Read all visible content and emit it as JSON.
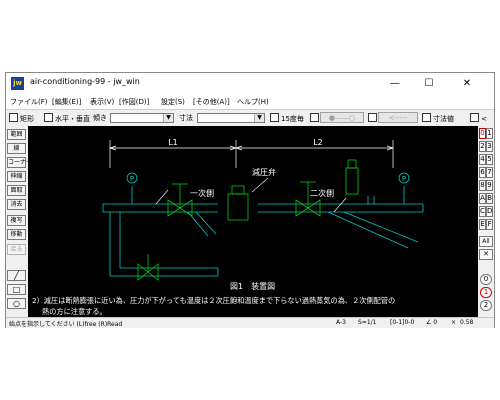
{
  "window": {
    "app_icon_text": "jw",
    "title": "air-conditioning-99 - jw_win",
    "minimize": "—",
    "maximize": "☐",
    "close": "✕"
  },
  "menu": [
    "ファイル(F)",
    "[編集(E)]",
    "表示(V)",
    "[作図(D)]",
    "設定(S)",
    "[その他(A)]",
    "ヘルプ(H)"
  ],
  "toolbar": {
    "rect": "矩形",
    "horiz_vert": "水平・垂直",
    "slope_label": "傾き",
    "dimension_label": "寸法",
    "deg15": "15度毎",
    "grayed_1": "●——○",
    "grayed_2": "<-----",
    "dim_value": "寸法値",
    "lt": "<"
  },
  "left_tools": [
    "範囲",
    "線",
    "コーナー",
    "伸縮",
    "面取",
    "消去",
    "複写",
    "移動",
    "戻る"
  ],
  "right_layers": [
    "0",
    "1",
    "2",
    "3",
    "4",
    "5",
    "6",
    "7",
    "8",
    "9",
    "A",
    "B",
    "C",
    "D",
    "E",
    "F"
  ],
  "right_all": "All",
  "right_x": "✕",
  "right_bottom": [
    "0",
    "1",
    "2"
  ],
  "drawing": {
    "L1": "L1",
    "L2": "L2",
    "reducing_valve": "減圧弁",
    "primary_side": "一次側",
    "secondary_side": "二次側",
    "gauge": "P",
    "figure_caption": "図1　装置図",
    "note_line1": "2）減圧は断熱膨張に近い為、圧力が下がっても温度は２次圧飽和温度まで下らない過熱蒸気の為、２次側配管の",
    "note_line2": "熱の方に注意する。"
  },
  "status": {
    "prompt": "始点を指示してください (L)free (R)Read",
    "paper": "A-3",
    "scale": "S=1/1",
    "layer": "[0-1]0-0",
    "zoom_icon": "×",
    "zoom": "0.58",
    "angle": "∠ 0"
  },
  "colors": {
    "canvas_bg": "#000000",
    "pipe": "#00c8c8",
    "dim": "#ffffff",
    "valve": "#00d000",
    "text": "#ffffff",
    "highlight": "#d00000"
  }
}
